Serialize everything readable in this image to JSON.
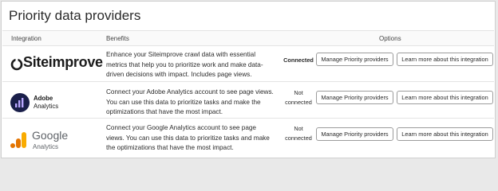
{
  "title": "Priority data providers",
  "columns": {
    "integration": "Integration",
    "benefits": "Benefits",
    "options": "Options"
  },
  "rows": [
    {
      "name": "Siteimprove",
      "benefit": "Enhance your Siteimprove crawl data with essential metrics that help you to prioritize work and make data-driven decisions with impact. Includes page views.",
      "status": "Connected",
      "manage_label": "Manage Priority providers",
      "learn_label": "Learn more about this integration"
    },
    {
      "name": "Adobe",
      "sub": "Analytics",
      "benefit": "Connect your Adobe Analytics account to see page views. You can use this data to prioritize tasks and make the optimizations that have the most impact.",
      "status": "Not connected",
      "manage_label": "Manage Priority providers",
      "learn_label": "Learn more about this integration"
    },
    {
      "name": "Google",
      "sub": "Analytics",
      "benefit": "Connect your Google Analytics account to see page views. You can use this data to prioritize tasks and make the optimizations that have the most impact.",
      "status": "Not connected",
      "manage_label": "Manage Priority providers",
      "learn_label": "Learn more about this integration"
    }
  ],
  "icons": {
    "siteimprove": "siteimprove-logo-icon",
    "adobe": "adobe-analytics-logo-icon",
    "google": "google-analytics-logo-icon"
  },
  "colors": {
    "adobe_circle": "#1a1f4a",
    "google_orange": "#f9ab00",
    "google_dark_orange": "#e37400"
  }
}
